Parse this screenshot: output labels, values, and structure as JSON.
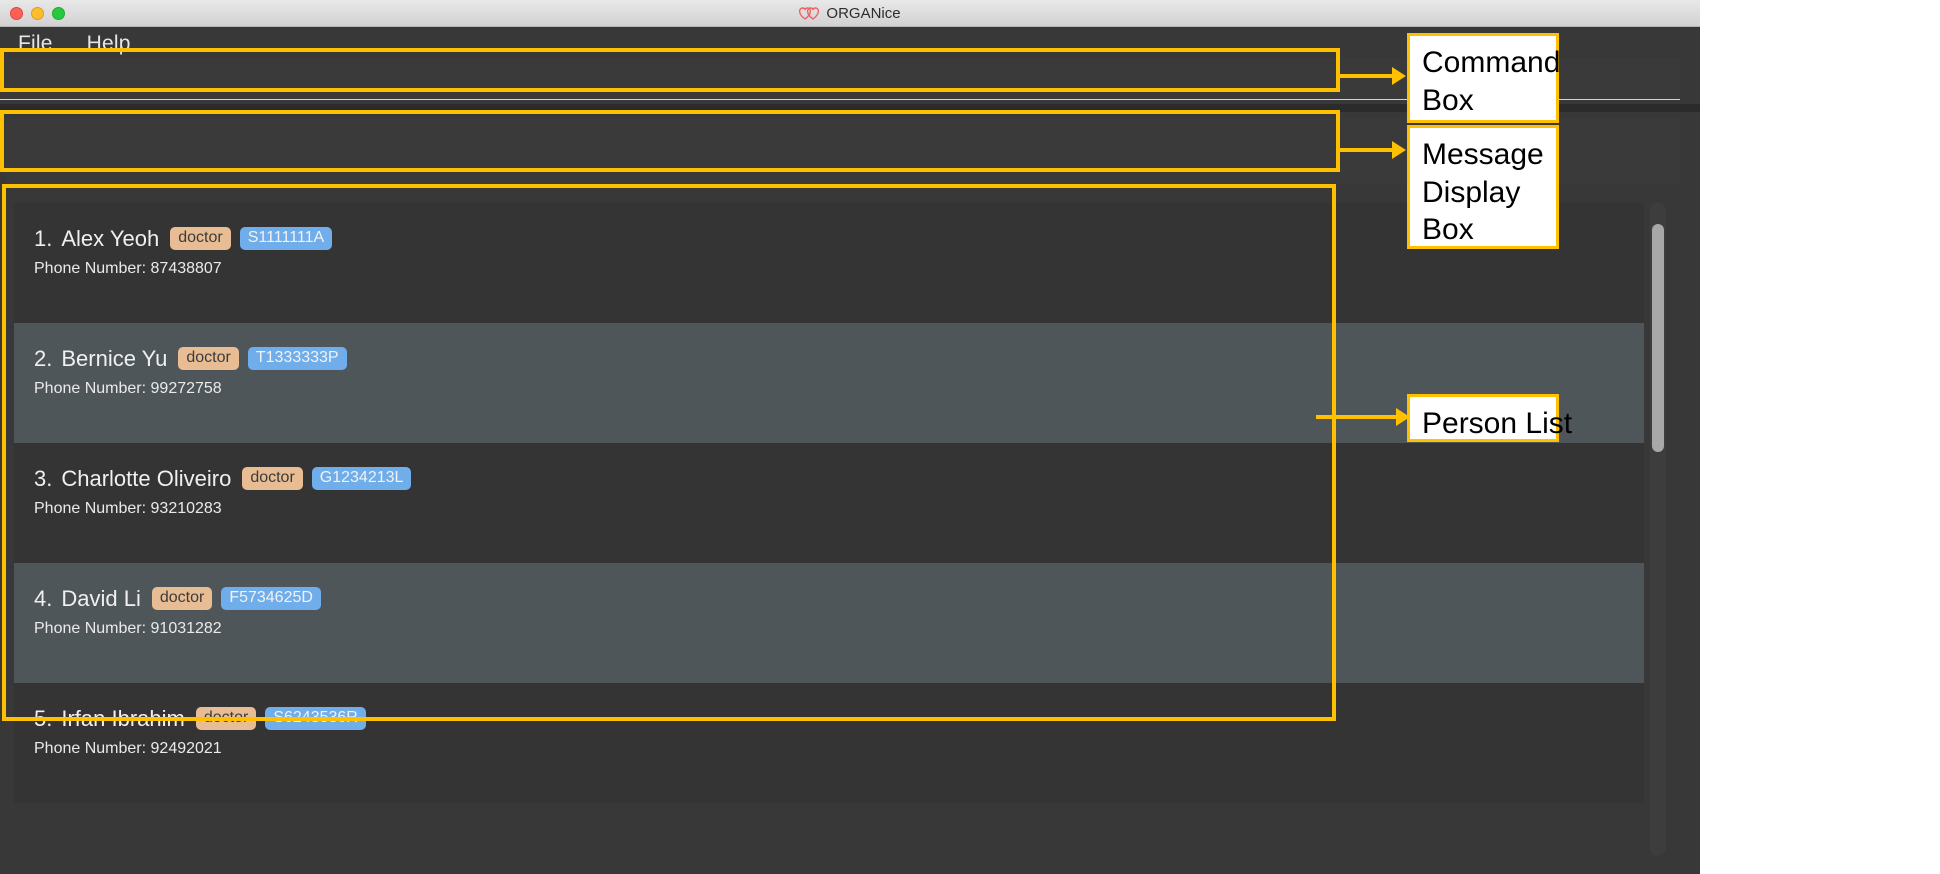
{
  "window": {
    "title": "ORGANice",
    "title_icon": "double-heart-icon",
    "traffic_lights": [
      "close-red",
      "minimize-yellow",
      "zoom-green"
    ]
  },
  "menubar": {
    "items": [
      {
        "label": "File"
      },
      {
        "label": "Help"
      }
    ]
  },
  "command_box": {
    "value": "",
    "placeholder": ""
  },
  "message_box": {
    "text": ""
  },
  "person_list": {
    "persons": [
      {
        "index": "1.",
        "name": "Alex Yeoh",
        "role_tag": "doctor",
        "id_tag": "S1111111A",
        "phone_label": "Phone Number:",
        "phone": "87438807"
      },
      {
        "index": "2.",
        "name": "Bernice Yu",
        "role_tag": "doctor",
        "id_tag": "T1333333P",
        "phone_label": "Phone Number:",
        "phone": "99272758"
      },
      {
        "index": "3.",
        "name": "Charlotte Oliveiro",
        "role_tag": "doctor",
        "id_tag": "G1234213L",
        "phone_label": "Phone Number:",
        "phone": "93210283"
      },
      {
        "index": "4.",
        "name": "David Li",
        "role_tag": "doctor",
        "id_tag": "F5734625D",
        "phone_label": "Phone Number:",
        "phone": "91031282"
      },
      {
        "index": "5.",
        "name": "Irfan Ibrahim",
        "role_tag": "doctor",
        "id_tag": "S6243536R",
        "phone_label": "Phone Number:",
        "phone": "92492021"
      }
    ]
  },
  "annotations": [
    {
      "label": "Command Box"
    },
    {
      "label": "Message Display Box"
    },
    {
      "label": "Person List"
    }
  ],
  "colors": {
    "annotation": "#ffc000",
    "role_tag_bg": "#e9bd94",
    "id_tag_bg": "#6fadeb",
    "window_bg": "#383838",
    "row_odd": "#343434",
    "row_even": "#4e5659"
  }
}
